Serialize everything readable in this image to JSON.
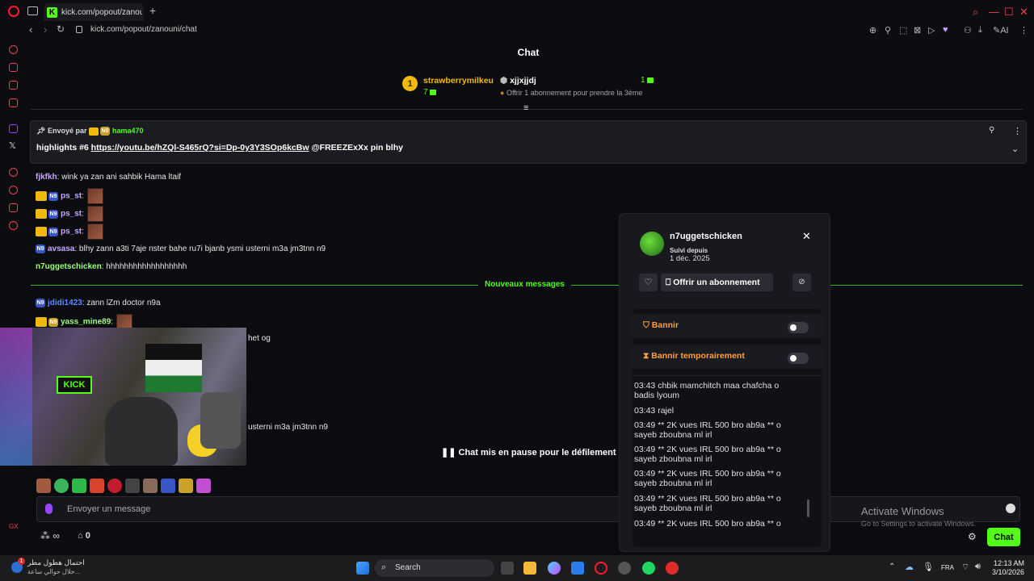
{
  "browser": {
    "tab_title": "kick.com/popout/zanouni/",
    "tab_logo": "K",
    "url": "kick.com/popout/zanouni/chat"
  },
  "chat": {
    "title": "Chat",
    "top_gifter": {
      "rank": "1",
      "name": "strawberrymilkeu",
      "count": "7"
    },
    "gift_user": {
      "name": "xjjxjjdj",
      "count": "1",
      "note": "Offrir 1 abonnement pour prendre la 3ème"
    },
    "pinned": {
      "label": "Envoyé par",
      "user": "hama470",
      "text_before": "highlights #6 ",
      "link": "https://youtu.be/hZQl-S465rQ?si=Dp-0y3Y3SOp6kcBw",
      "text_after": " @FREEZExXx pin blhy"
    },
    "messages": [
      {
        "user": "fjkfkh",
        "text": ": wink ya zan ani sahbik Hama ltaif",
        "color": "#c9a7ff"
      },
      {
        "user": "ps_st",
        "text": ":",
        "color": "#c9a7ff"
      },
      {
        "user": "ps_st",
        "text": ":",
        "color": "#c9a7ff"
      },
      {
        "user": "ps_st",
        "text": ":",
        "color": "#c9a7ff"
      },
      {
        "user": "avsasa",
        "text": ": blhy zann a3ti 7aje nster bahe ru7i bjanb ysmi usterni m3a jm3tnn n9",
        "color": "#c9a7ff"
      },
      {
        "user": "n7uggetschicken",
        "text": ": hhhhhhhhhhhhhhhhhh",
        "color": "#9dff7a"
      }
    ],
    "divider": "Nouveaux messages",
    "new_messages": [
      {
        "user": "jdidi1423",
        "text": ": zann lZm doctor n9a",
        "color": "#5b8cff"
      },
      {
        "user": "yass_mine89",
        "text": ":",
        "color": "#9dff7a"
      }
    ],
    "partial_1": "het og",
    "partial_2": "usterni m3a jm3tnn n9",
    "paused": "Chat mis en pause pour le défilement",
    "input_placeholder": "Envoyer un message",
    "points": "0",
    "send": "Chat"
  },
  "user_card": {
    "username": "n7uggetschicken",
    "followed_label": "Suivi depuis",
    "followed_date": "1 déc. 2025",
    "gift_button": "Offrir un abonnement",
    "ban": "Bannir",
    "timeout": "Bannir temporairement",
    "history": [
      "03:43 chbik mamchitch maa chafcha o badis lyoum",
      "03:43 rajel",
      "03:49 ** 2K vues IRL 500 bro ab9a ** o sayeb zboubna ml irl",
      "03:49 ** 2K vues IRL 500 bro ab9a ** o sayeb zboubna ml irl",
      "03:49 ** 2K vues IRL 500 bro ab9a ** o sayeb zboubna ml irl",
      "03:49 ** 2K vues IRL 500 bro ab9a ** o sayeb zboubna ml irl",
      "03:49 ** 2K vues IRL 500 bro ab9a ** o"
    ]
  },
  "watermark": {
    "line1": "Activate Windows",
    "line2": "Go to Settings to activate Windows."
  },
  "taskbar": {
    "weather_title": "احتمال هطول مطر",
    "weather_sub": "خلال حوالي ساعة...",
    "notif_count": "1",
    "search": "Search",
    "lang": "FRA",
    "time": "12:13 AM",
    "date": "3/10/2026"
  },
  "colors": {
    "kick_green": "#53fc18",
    "opera_red": "#ff1b2d",
    "gold": "#f0b90b",
    "ban_orange": "#ff9f3a"
  }
}
